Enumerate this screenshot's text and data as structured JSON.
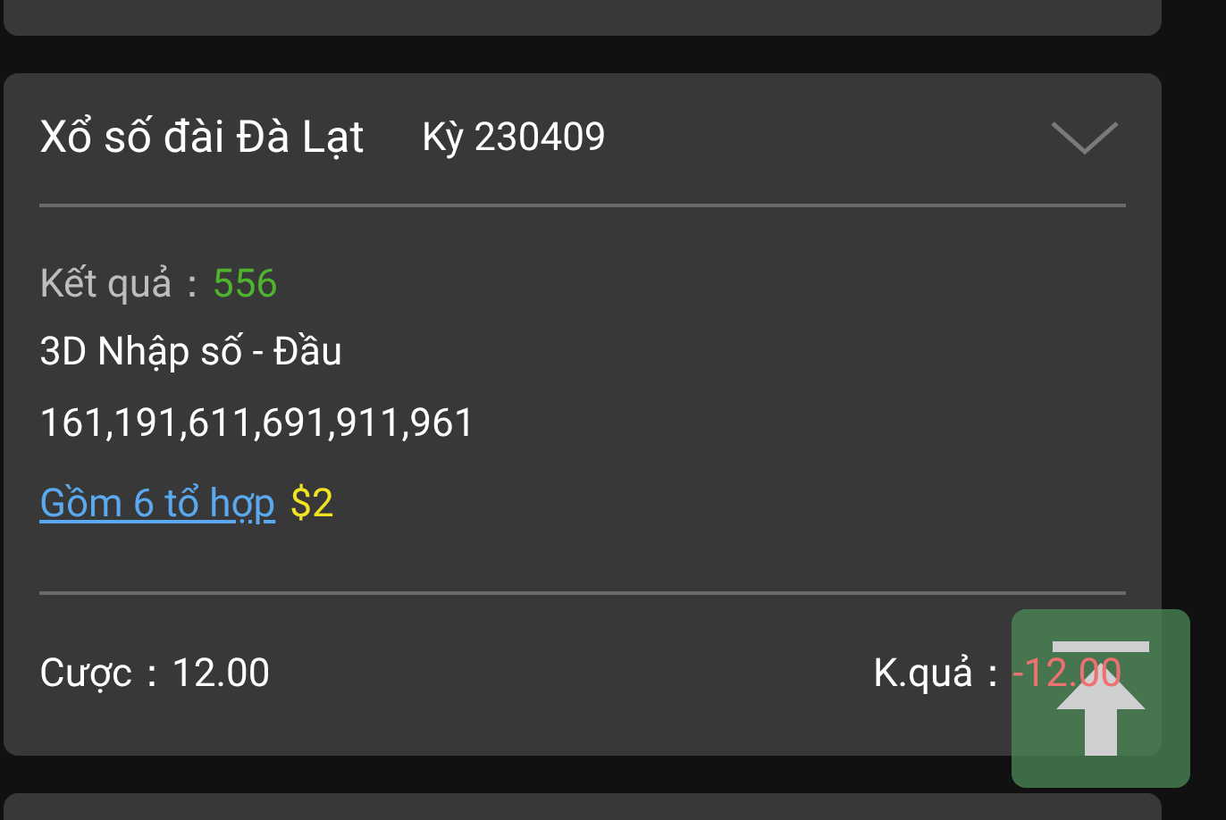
{
  "ticket": {
    "title": "Xổ số đài Đà Lạt",
    "period": "Kỳ 230409",
    "result_label": "Kết quả：",
    "result_value": "556",
    "bet_type": "3D Nhập số - Đầu",
    "numbers": "161,191,611,691,911,961",
    "combos_link": "Gồm 6 tổ hợp",
    "combos_price": "$2",
    "bet_label": "Cược：",
    "bet_value": "12.00",
    "outcome_label": "K.quả：",
    "outcome_value": "-12.00"
  }
}
